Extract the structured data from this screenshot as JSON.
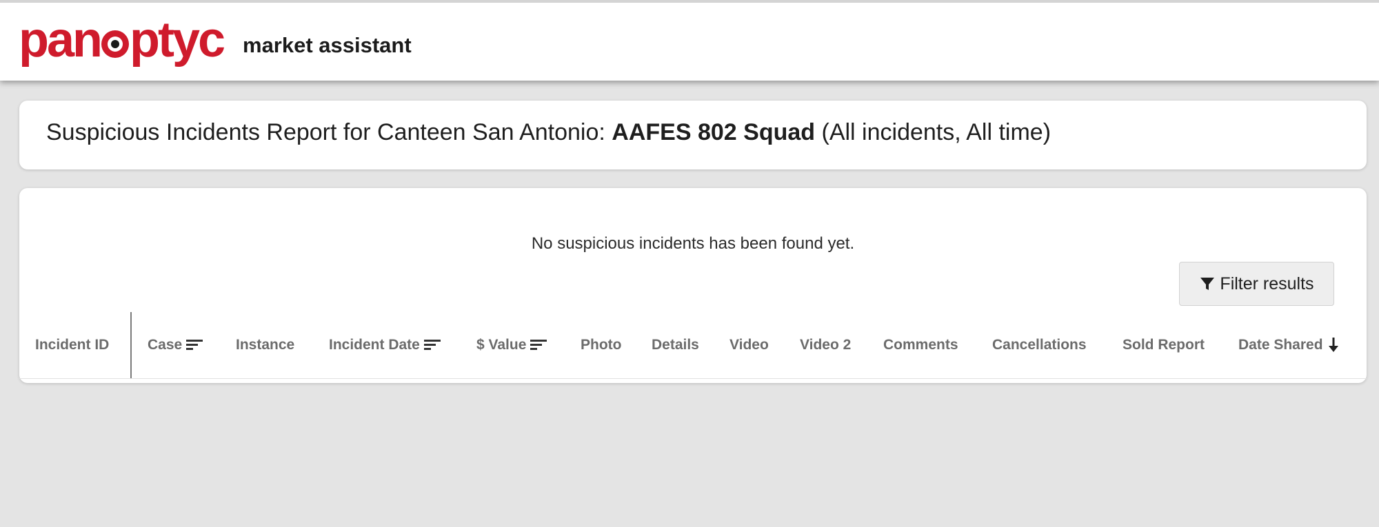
{
  "header": {
    "logo_text_left": "pan",
    "logo_text_right": "ptyc",
    "subtitle": "market assistant"
  },
  "report": {
    "title_prefix": "Suspicious Incidents Report for Canteen San Antonio: ",
    "title_bold": "AAFES 802 Squad",
    "title_suffix": " (All incidents, All time)"
  },
  "table": {
    "empty_message": "No suspicious incidents has been found yet.",
    "filter_label": "Filter results",
    "columns": [
      {
        "label": "Incident ID",
        "sort_icon": "none"
      },
      {
        "label": "Case",
        "sort_icon": "sort-lines-icon"
      },
      {
        "label": "Instance",
        "sort_icon": "none"
      },
      {
        "label": "Incident Date",
        "sort_icon": "sort-lines-icon"
      },
      {
        "label": "$ Value",
        "sort_icon": "sort-lines-icon"
      },
      {
        "label": "Photo",
        "sort_icon": "none"
      },
      {
        "label": "Details",
        "sort_icon": "none"
      },
      {
        "label": "Video",
        "sort_icon": "none"
      },
      {
        "label": "Video 2",
        "sort_icon": "none"
      },
      {
        "label": "Comments",
        "sort_icon": "none"
      },
      {
        "label": "Cancellations",
        "sort_icon": "none"
      },
      {
        "label": "Sold Report",
        "sort_icon": "none"
      },
      {
        "label": "Date Shared",
        "sort_icon": "arrow-down-icon"
      }
    ]
  },
  "colors": {
    "brand_red": "#cf1b2c",
    "background": "#e4e4e4",
    "header_text": "#6b6b6b"
  }
}
